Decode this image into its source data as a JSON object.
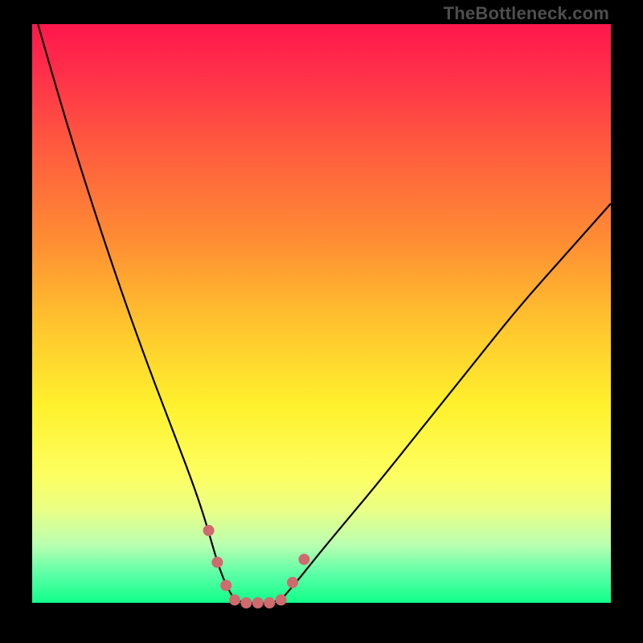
{
  "watermark": "TheBottleneck.com",
  "chart_data": {
    "type": "line",
    "title": "",
    "xlabel": "",
    "ylabel": "",
    "xlim": [
      0,
      100
    ],
    "ylim": [
      0,
      100
    ],
    "series": [
      {
        "name": "bottleneck-curve-left",
        "x": [
          1,
          5,
          10,
          15,
          20,
          25,
          28,
          30,
          32,
          33.5,
          35
        ],
        "values": [
          100,
          86,
          70,
          55,
          41,
          28,
          20,
          14,
          7,
          3,
          0.5
        ]
      },
      {
        "name": "bottleneck-curve-flat",
        "x": [
          35,
          37,
          39,
          41,
          43
        ],
        "values": [
          0.5,
          0,
          0,
          0,
          0.5
        ]
      },
      {
        "name": "bottleneck-curve-right",
        "x": [
          43,
          46,
          50,
          55,
          60,
          68,
          76,
          84,
          92,
          100
        ],
        "values": [
          0.5,
          4,
          9,
          15,
          21,
          31,
          41,
          51,
          60,
          69
        ]
      }
    ],
    "highlights": {
      "name": "dashed-highlight-pink",
      "color": "#cf6a6f",
      "x": [
        30.5,
        32,
        33.5,
        35,
        37,
        39,
        41,
        43,
        45,
        47
      ],
      "values": [
        12.5,
        7,
        3,
        0.5,
        0,
        0,
        0,
        0.5,
        3.5,
        7.5
      ]
    }
  },
  "colors": {
    "curve": "#000000",
    "highlight": "#cf6a6f",
    "background_top": "#ff174c",
    "background_bottom": "#10ff8a"
  }
}
